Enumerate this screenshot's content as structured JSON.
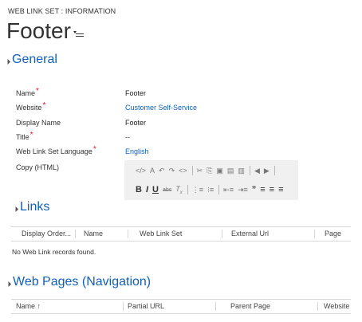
{
  "header": {
    "entity_type": "WEB LINK SET : INFORMATION",
    "record_title": "Footer"
  },
  "general": {
    "heading": "General",
    "fields": [
      {
        "label": "Name",
        "required": true,
        "value": "Footer",
        "is_link": false
      },
      {
        "label": "Website",
        "required": true,
        "value": "Customer Self-Service",
        "is_link": true
      },
      {
        "label": "Display Name",
        "required": false,
        "value": "Footer",
        "is_link": false
      },
      {
        "label": "Title",
        "required": true,
        "value": "--",
        "is_link": false
      },
      {
        "label": "Web Link Set Language",
        "required": true,
        "value": "English",
        "is_link": true
      },
      {
        "label": "Copy (HTML)",
        "required": false,
        "value": "",
        "is_link": false
      }
    ],
    "required_marker": "*",
    "editor_toolbar": {
      "row1": [
        "source-icon",
        "font-color-icon",
        "undo-icon",
        "redo-icon",
        "code-icon",
        "cut-icon",
        "copy-icon",
        "paste-icon",
        "paste-text-icon",
        "paste-word-icon",
        "back-icon",
        "forward-icon"
      ],
      "row2": [
        "bold-icon",
        "italic-icon",
        "underline-icon",
        "strikethrough-icon",
        "remove-format-icon",
        "numbered-list-icon",
        "bulleted-list-icon",
        "outdent-icon",
        "indent-icon",
        "blockquote-icon",
        "align-left-icon",
        "align-center-icon",
        "align-right-icon"
      ]
    }
  },
  "links": {
    "heading": "Links",
    "columns": [
      "Display Order...",
      "Name",
      "Web Link Set",
      "External Url",
      "Page"
    ],
    "empty_message": "No Web Link records found."
  },
  "web_pages": {
    "heading": "Web Pages (Navigation)",
    "columns": [
      "Name ↑",
      "Partial URL",
      "Parent Page",
      "Website"
    ]
  },
  "colors": {
    "accent": "#1160b7",
    "required": "#e81123",
    "editor_bg": "#f0f0f0"
  }
}
